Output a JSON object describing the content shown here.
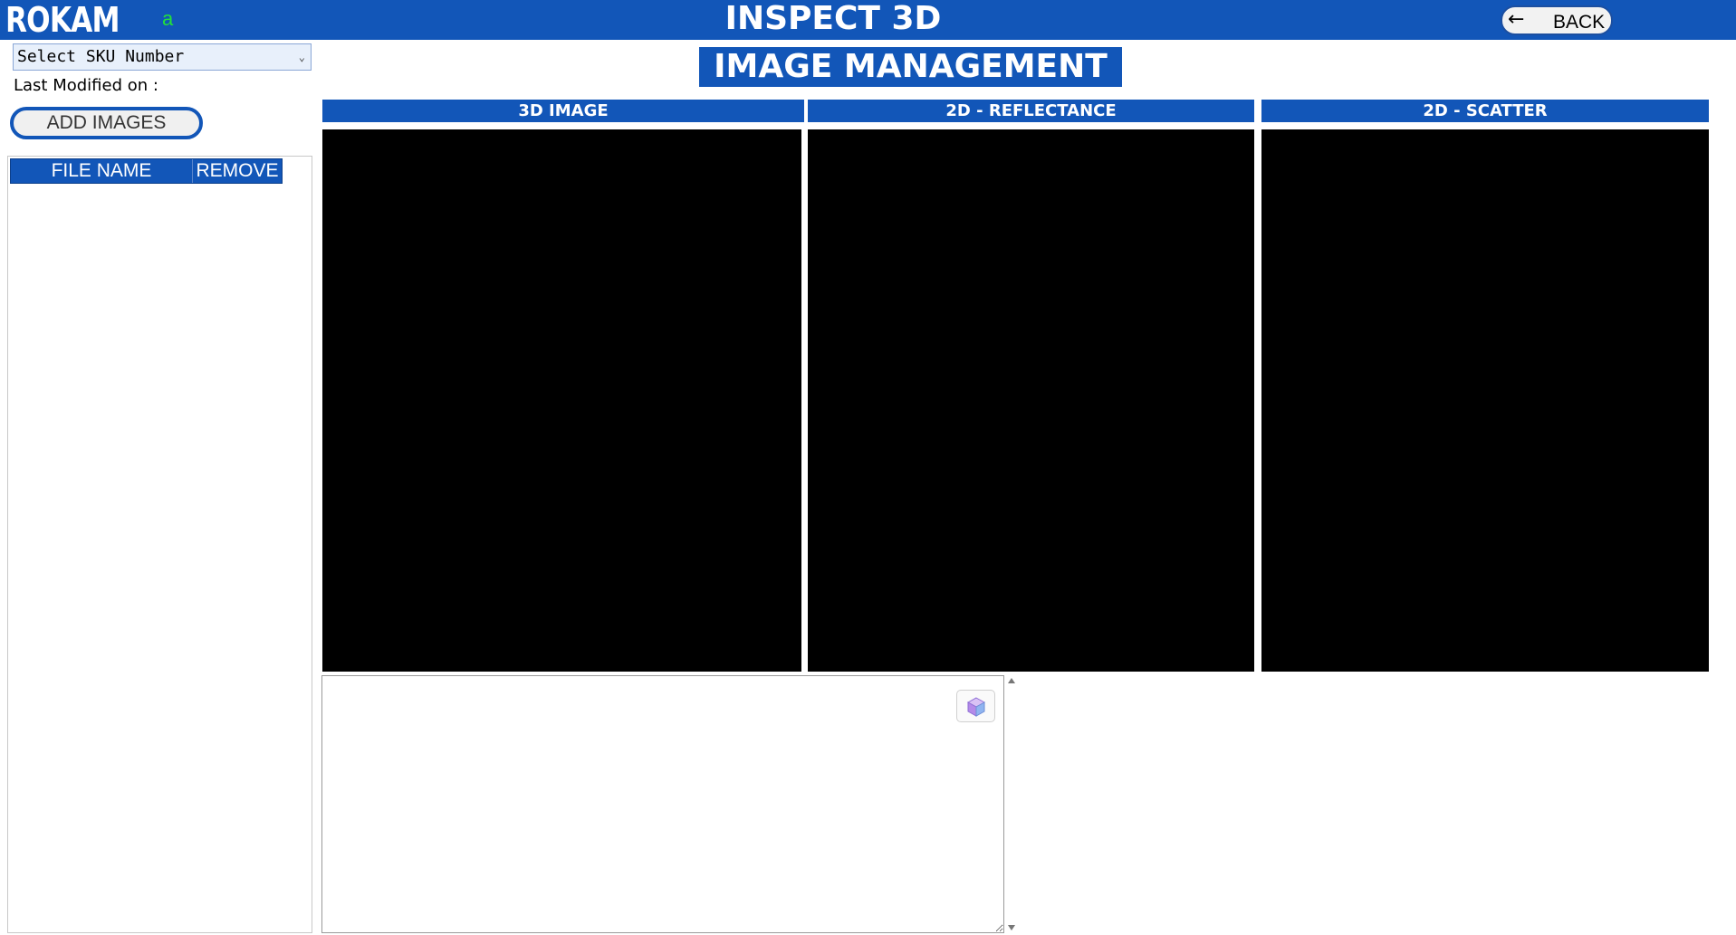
{
  "header": {
    "logo": "ROKAM",
    "user": "a",
    "title": "INSPECT 3D",
    "back_label": "BACK",
    "back_icon": "arrow-left-icon"
  },
  "left_panel": {
    "sku_select": {
      "selected": "Select SKU Number",
      "chevron_icon": "chevron-down-icon"
    },
    "last_modified_label": "Last Modified on :",
    "add_images_label": "ADD IMAGES",
    "file_table": {
      "columns": [
        "FILE NAME",
        "REMOVE"
      ],
      "rows": []
    }
  },
  "main": {
    "section_title": "IMAGE MANAGEMENT",
    "panels": [
      {
        "label": "3D IMAGE"
      },
      {
        "label": "2D - REFLECTANCE"
      },
      {
        "label": "2D - SCATTER"
      }
    ],
    "notes": {
      "value": "",
      "tool_icon": "cube-icon"
    }
  },
  "colors": {
    "brand_blue": "#1256b8",
    "user_green": "#22e03a",
    "viewer_background": "#000000"
  }
}
